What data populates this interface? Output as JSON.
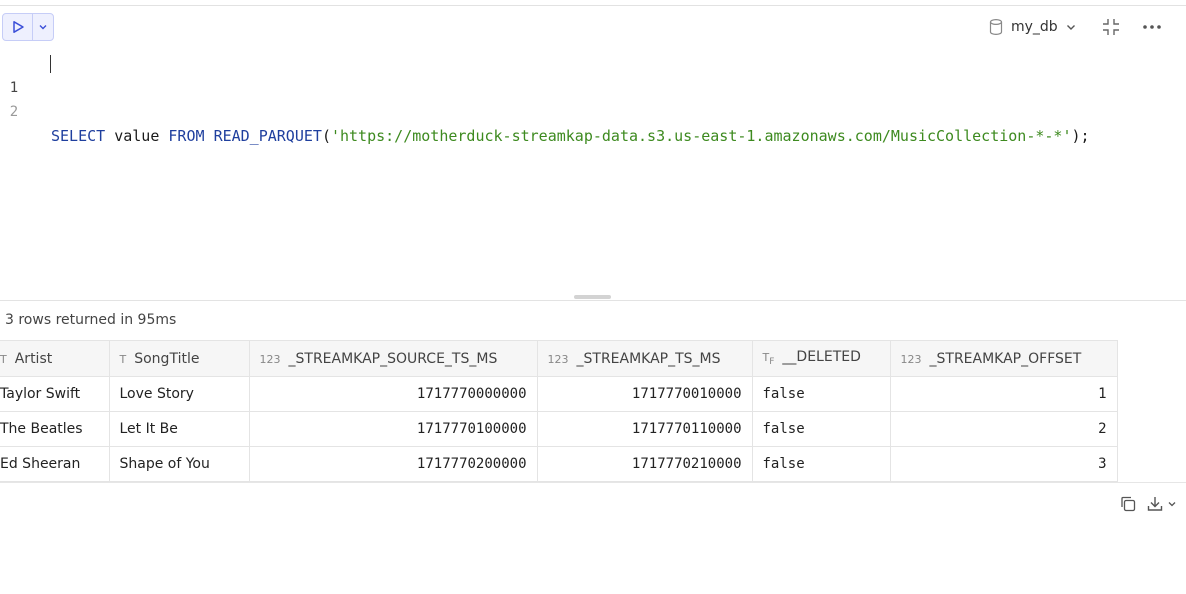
{
  "toolbar": {
    "database": "my_db"
  },
  "editor": {
    "lines": [
      {
        "number": "1",
        "tokens": {
          "select": "SELECT",
          "value": " value ",
          "from": "FROM",
          "space": " ",
          "fn": "READ_PARQUET",
          "open": "(",
          "url": "'https://motherduck-streamkap-data.s3.us-east-1.amazonaws.com/MusicCollection-*-*'",
          "close": ");"
        }
      },
      {
        "number": "2"
      }
    ]
  },
  "status": "3 rows returned in 95ms",
  "table": {
    "columns": [
      {
        "type": "T",
        "name": "Artist"
      },
      {
        "type": "T",
        "name": "SongTitle"
      },
      {
        "type": "123",
        "name": "_STREAMKAP_SOURCE_TS_MS"
      },
      {
        "type": "123",
        "name": "_STREAMKAP_TS_MS"
      },
      {
        "type": "TF",
        "name": "__DELETED"
      },
      {
        "type": "123",
        "name": "_STREAMKAP_OFFSET"
      }
    ],
    "rows": [
      [
        "Taylor Swift",
        "Love Story",
        "1717770000000",
        "1717770010000",
        "false",
        "1"
      ],
      [
        "The Beatles",
        "Let It Be",
        "1717770100000",
        "1717770110000",
        "false",
        "2"
      ],
      [
        "Ed Sheeran",
        "Shape of You",
        "1717770200000",
        "1717770210000",
        "false",
        "3"
      ]
    ]
  },
  "colors": {
    "keyword": "#1f3f9e",
    "string": "#3d8a1f",
    "run_accent": "#3b4fd8"
  },
  "icons": [
    "play-icon",
    "chevron-down-icon",
    "database-icon",
    "collapse-icon",
    "more-icon",
    "copy-icon",
    "download-icon"
  ]
}
